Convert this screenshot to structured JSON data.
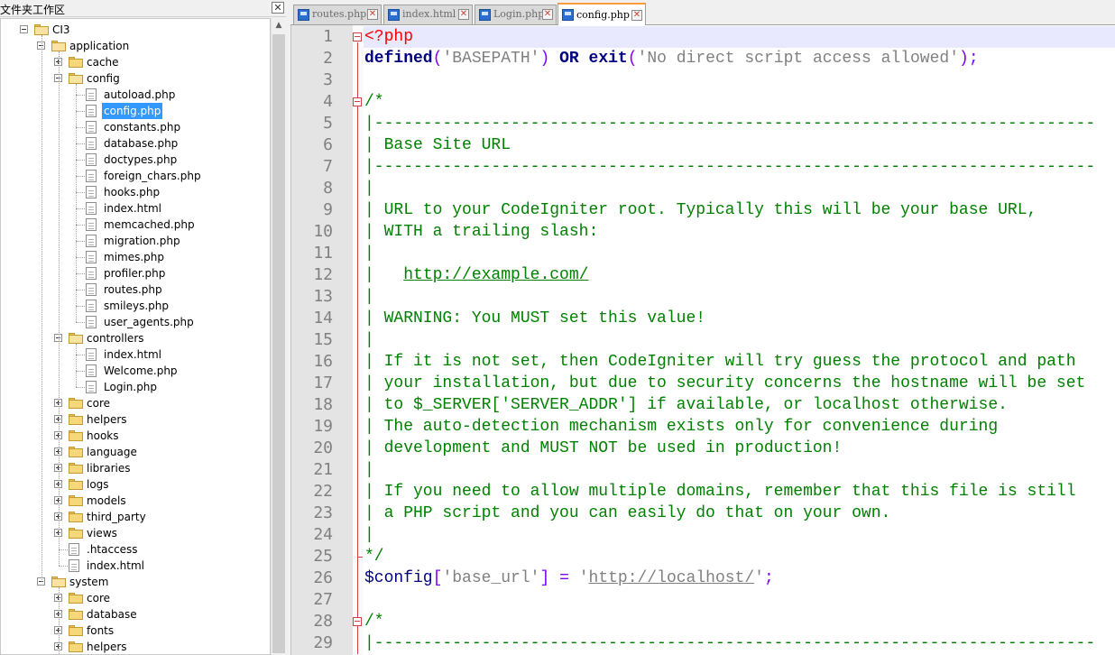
{
  "panel": {
    "title": "文件夹工作区",
    "close": "✕"
  },
  "tree": [
    {
      "label": "CI3",
      "kind": "folder",
      "open": true,
      "depth": 0
    },
    {
      "label": "application",
      "kind": "folder",
      "open": true,
      "depth": 1
    },
    {
      "label": "cache",
      "kind": "folder",
      "open": false,
      "depth": 2
    },
    {
      "label": "config",
      "kind": "folder",
      "open": true,
      "depth": 2
    },
    {
      "label": "autoload.php",
      "kind": "file",
      "depth": 3
    },
    {
      "label": "config.php",
      "kind": "file",
      "depth": 3,
      "selected": true
    },
    {
      "label": "constants.php",
      "kind": "file",
      "depth": 3
    },
    {
      "label": "database.php",
      "kind": "file",
      "depth": 3
    },
    {
      "label": "doctypes.php",
      "kind": "file",
      "depth": 3
    },
    {
      "label": "foreign_chars.php",
      "kind": "file",
      "depth": 3
    },
    {
      "label": "hooks.php",
      "kind": "file",
      "depth": 3
    },
    {
      "label": "index.html",
      "kind": "file",
      "depth": 3
    },
    {
      "label": "memcached.php",
      "kind": "file",
      "depth": 3
    },
    {
      "label": "migration.php",
      "kind": "file",
      "depth": 3
    },
    {
      "label": "mimes.php",
      "kind": "file",
      "depth": 3
    },
    {
      "label": "profiler.php",
      "kind": "file",
      "depth": 3
    },
    {
      "label": "routes.php",
      "kind": "file",
      "depth": 3
    },
    {
      "label": "smileys.php",
      "kind": "file",
      "depth": 3
    },
    {
      "label": "user_agents.php",
      "kind": "file",
      "depth": 3
    },
    {
      "label": "controllers",
      "kind": "folder",
      "open": true,
      "depth": 2
    },
    {
      "label": "index.html",
      "kind": "file",
      "depth": 3
    },
    {
      "label": "Welcome.php",
      "kind": "file",
      "depth": 3
    },
    {
      "label": "Login.php",
      "kind": "file",
      "depth": 3
    },
    {
      "label": "core",
      "kind": "folder",
      "open": false,
      "depth": 2
    },
    {
      "label": "helpers",
      "kind": "folder",
      "open": false,
      "depth": 2
    },
    {
      "label": "hooks",
      "kind": "folder",
      "open": false,
      "depth": 2
    },
    {
      "label": "language",
      "kind": "folder",
      "open": false,
      "depth": 2
    },
    {
      "label": "libraries",
      "kind": "folder",
      "open": false,
      "depth": 2
    },
    {
      "label": "logs",
      "kind": "folder",
      "open": false,
      "depth": 2
    },
    {
      "label": "models",
      "kind": "folder",
      "open": false,
      "depth": 2
    },
    {
      "label": "third_party",
      "kind": "folder",
      "open": false,
      "depth": 2
    },
    {
      "label": "views",
      "kind": "folder",
      "open": false,
      "depth": 2
    },
    {
      "label": ".htaccess",
      "kind": "file",
      "depth": 2
    },
    {
      "label": "index.html",
      "kind": "file",
      "depth": 2
    },
    {
      "label": "system",
      "kind": "folder",
      "open": true,
      "depth": 1
    },
    {
      "label": "core",
      "kind": "folder",
      "open": false,
      "depth": 2
    },
    {
      "label": "database",
      "kind": "folder",
      "open": false,
      "depth": 2
    },
    {
      "label": "fonts",
      "kind": "folder",
      "open": false,
      "depth": 2
    },
    {
      "label": "helpers",
      "kind": "folder",
      "open": false,
      "depth": 2
    }
  ],
  "tabs": [
    {
      "label": "routes.php",
      "active": false
    },
    {
      "label": "index.html",
      "active": false
    },
    {
      "label": "Login.php",
      "active": false
    },
    {
      "label": "config.php",
      "active": true
    }
  ],
  "code": [
    [
      [
        "php",
        "<?php"
      ]
    ],
    [
      [
        "kw",
        "defined"
      ],
      [
        "op",
        "("
      ],
      [
        "str",
        "'BASEPATH'"
      ],
      [
        "op",
        ")"
      ],
      [
        "plain",
        " "
      ],
      [
        "kw",
        "OR"
      ],
      [
        "plain",
        " "
      ],
      [
        "kw",
        "exit"
      ],
      [
        "op",
        "("
      ],
      [
        "str",
        "'No direct script access allowed'"
      ],
      [
        "op",
        ");"
      ]
    ],
    [],
    [
      [
        "cm",
        "/*"
      ]
    ],
    [
      [
        "cm",
        "|--------------------------------------------------------------------------"
      ]
    ],
    [
      [
        "cm",
        "| Base Site URL"
      ]
    ],
    [
      [
        "cm",
        "|--------------------------------------------------------------------------"
      ]
    ],
    [
      [
        "cm",
        "|"
      ]
    ],
    [
      [
        "cm",
        "| URL to your CodeIgniter root. Typically this will be your base URL,"
      ]
    ],
    [
      [
        "cm",
        "| WITH a trailing slash:"
      ]
    ],
    [
      [
        "cm",
        "|"
      ]
    ],
    [
      [
        "cm",
        "|   "
      ],
      [
        "url",
        "http://example.com/"
      ]
    ],
    [
      [
        "cm",
        "|"
      ]
    ],
    [
      [
        "cm",
        "| WARNING: You MUST set this value!"
      ]
    ],
    [
      [
        "cm",
        "|"
      ]
    ],
    [
      [
        "cm",
        "| If it is not set, then CodeIgniter will try guess the protocol and path"
      ]
    ],
    [
      [
        "cm",
        "| your installation, but due to security concerns the hostname will be set"
      ]
    ],
    [
      [
        "cm",
        "| to $_SERVER['SERVER_ADDR'] if available, or localhost otherwise."
      ]
    ],
    [
      [
        "cm",
        "| The auto-detection mechanism exists only for convenience during"
      ]
    ],
    [
      [
        "cm",
        "| development and MUST NOT be used in production!"
      ]
    ],
    [
      [
        "cm",
        "|"
      ]
    ],
    [
      [
        "cm",
        "| If you need to allow multiple domains, remember that this file is still"
      ]
    ],
    [
      [
        "cm",
        "| a PHP script and you can easily do that on your own."
      ]
    ],
    [
      [
        "cm",
        "|"
      ]
    ],
    [
      [
        "cm",
        "*/"
      ]
    ],
    [
      [
        "var",
        "$config"
      ],
      [
        "op",
        "["
      ],
      [
        "str",
        "'base_url'"
      ],
      [
        "op",
        "]"
      ],
      [
        "plain",
        " "
      ],
      [
        "op",
        "="
      ],
      [
        "plain",
        " "
      ],
      [
        "str",
        "'"
      ],
      [
        "urlstr",
        "http://localhost/"
      ],
      [
        "str",
        "'"
      ],
      [
        "op",
        ";"
      ]
    ],
    [],
    [
      [
        "cm",
        "/*"
      ]
    ],
    [
      [
        "cm",
        "|--------------------------------------------------------------------------"
      ]
    ]
  ],
  "colors": {
    "selection": "#3399ff",
    "active_tab_accent": "#fa9b3c",
    "fold_marker": "#d04040",
    "comment": "#008000",
    "keyword": "#000080",
    "string": "#808080",
    "php_tag": "#ff0000"
  }
}
